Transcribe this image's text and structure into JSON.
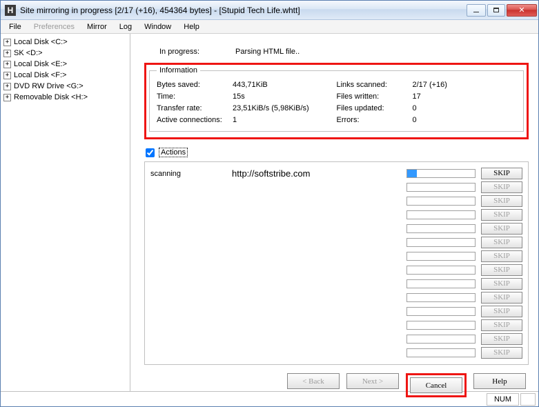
{
  "window": {
    "title": "Site mirroring in progress [2/17 (+16), 454364 bytes] - [Stupid Tech Life.whtt]",
    "app_icon_letter": "H"
  },
  "menu": {
    "file": "File",
    "preferences": "Preferences",
    "mirror": "Mirror",
    "log": "Log",
    "window": "Window",
    "help": "Help"
  },
  "tree": [
    "Local Disk <C:>",
    "SK <D:>",
    "Local Disk <E:>",
    "Local Disk <F:>",
    "DVD RW Drive <G:>",
    "Removable Disk <H:>"
  ],
  "progress": {
    "label": "In progress:",
    "value": "Parsing HTML file.."
  },
  "info": {
    "legend": "Information",
    "left": {
      "bytes_saved_k": "Bytes saved:",
      "bytes_saved_v": "443,71KiB",
      "time_k": "Time:",
      "time_v": "15s",
      "rate_k": "Transfer rate:",
      "rate_v": "23,51KiB/s (5,98KiB/s)",
      "act_k": "Active connections:",
      "act_v": "1"
    },
    "right": {
      "links_k": "Links scanned:",
      "links_v": "2/17 (+16)",
      "written_k": "Files written:",
      "written_v": "17",
      "updated_k": "Files updated:",
      "updated_v": "0",
      "errors_k": "Errors:",
      "errors_v": "0"
    }
  },
  "actions": {
    "label": "Actions"
  },
  "connections": {
    "scanning_label": "scanning",
    "scanning_url": "http://softstribe.com",
    "skip_label": "SKIP",
    "rows": 14
  },
  "buttons": {
    "back": "< Back",
    "next": "Next >",
    "cancel": "Cancel",
    "help": "Help"
  },
  "status": {
    "num": "NUM"
  }
}
